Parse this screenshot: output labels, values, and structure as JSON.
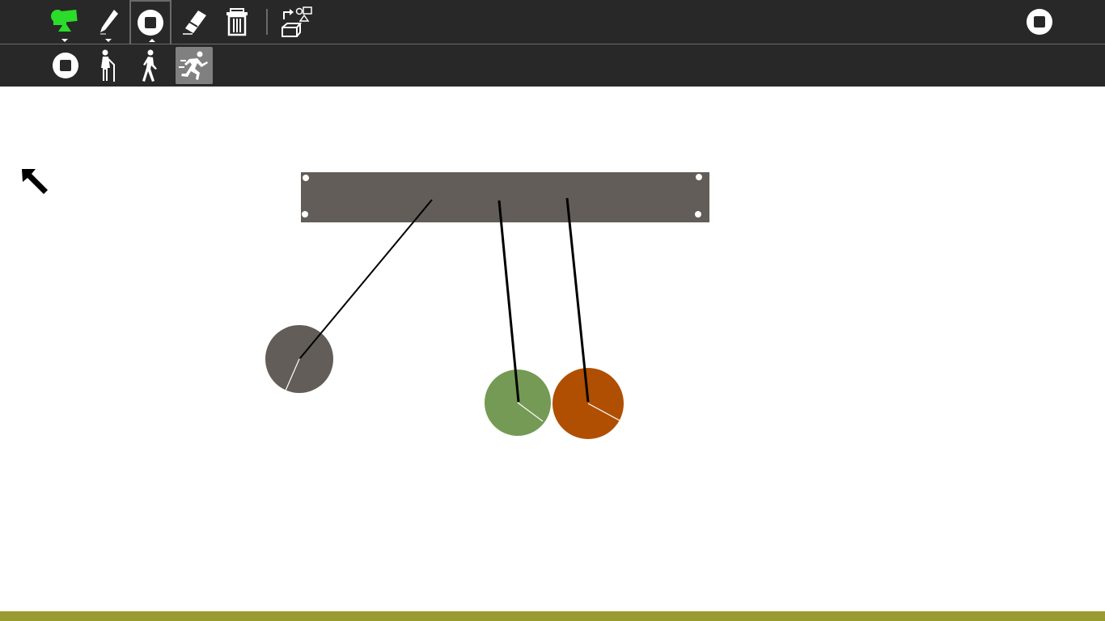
{
  "toolbar": {
    "items": [
      {
        "name": "activity-icon",
        "color": "#2bdc2b"
      },
      {
        "name": "pen-icon"
      },
      {
        "name": "stop-icon"
      },
      {
        "name": "eraser-icon"
      },
      {
        "name": "trash-icon"
      },
      {
        "name": "export-objects-icon"
      }
    ],
    "right_item": {
      "name": "stop-icon"
    }
  },
  "sub_toolbar": {
    "items": [
      {
        "name": "stop-icon"
      },
      {
        "name": "slow-walker-icon"
      },
      {
        "name": "walker-icon"
      },
      {
        "name": "runner-icon",
        "selected": true
      }
    ]
  },
  "canvas": {
    "cursor_icon": "arrow-up-left-icon",
    "colors": {
      "beam": "#625d58",
      "ball_gray": "#625d58",
      "ball_green": "#749a55",
      "ball_orange": "#b04f02",
      "rope": "#000000",
      "handle": "#ffffff"
    }
  },
  "bottom_bar": {
    "color": "#9a9a33"
  }
}
